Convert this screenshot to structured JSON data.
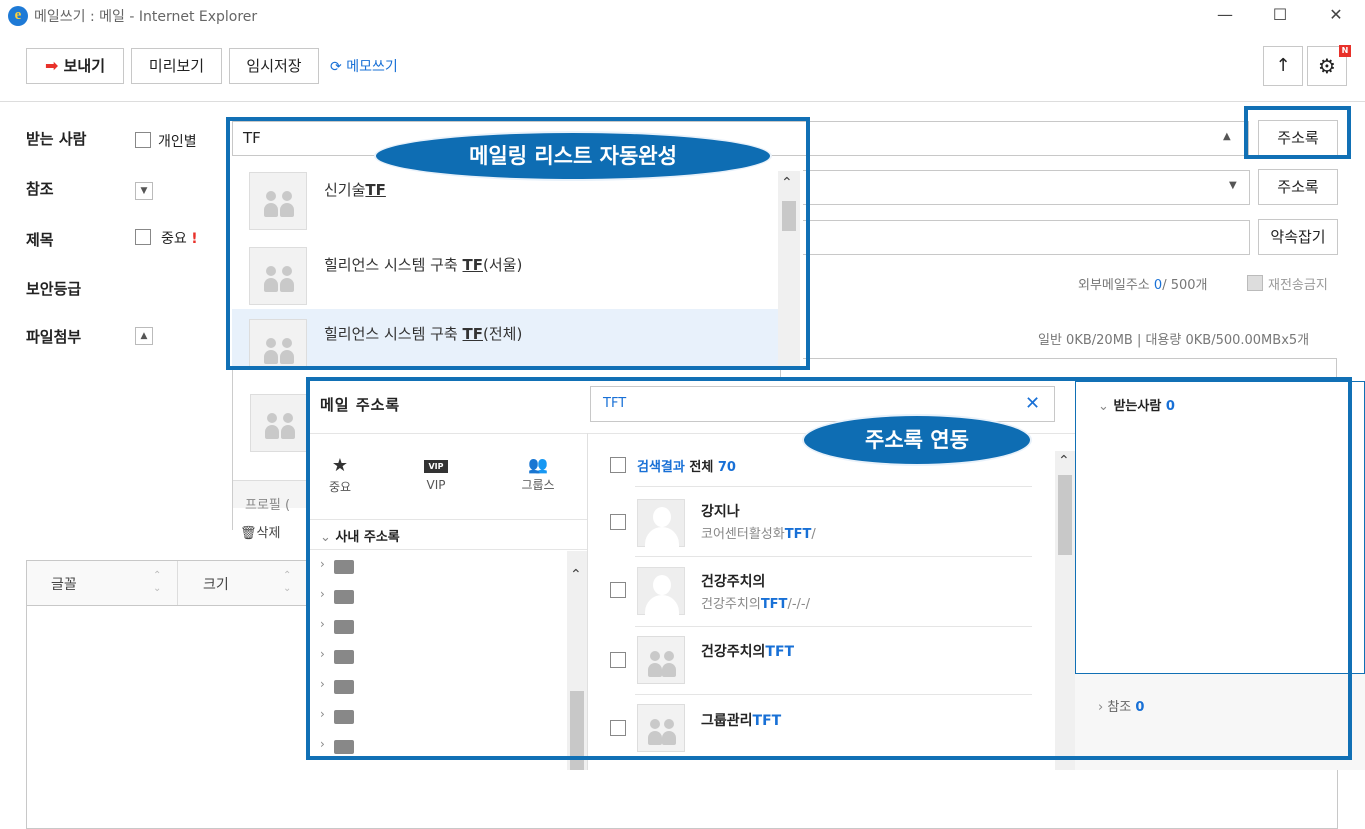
{
  "window": {
    "title": "메일쓰기 : 메일 - Internet Explorer",
    "minimize": "—",
    "maximize": "☐",
    "close": "✕"
  },
  "toolbar": {
    "send": "보내기",
    "preview": "미리보기",
    "draft": "임시저장",
    "memo": "메모쓰기",
    "upload_icon": "↑",
    "settings_badge": "N"
  },
  "form": {
    "to_label": "받는 사람",
    "individual_label": "개인별",
    "to_value": "TF",
    "address_book_btn": "주소록",
    "cc_label": "참조",
    "cc_address_book_btn": "주소록",
    "subject_label": "제목",
    "important_label": "중요",
    "important_mark": "!",
    "appointment_btn": "약속잡기",
    "security_label": "보안등급",
    "external_label": "외부메일주소",
    "external_count": "0",
    "external_limit": "/ 500개",
    "no_forward_label": "재전송금지",
    "attach_label": "파일첨부",
    "attach_info": "일반 0KB/20MB | 대용량 0KB/500.00MBx5개",
    "profile_text": "프로필 (",
    "delete_label": "삭제",
    "font_label": "글꼴",
    "size_label": "크기"
  },
  "autocomplete": {
    "callout": "메일링 리스트 자동완성",
    "items": [
      {
        "prefix": "신기술",
        "match": "TF",
        "suffix": ""
      },
      {
        "prefix": "힐리언스 시스템 구축 ",
        "match": "TF",
        "suffix": "(서울)"
      },
      {
        "prefix": "힐리언스 시스템 구축 ",
        "match": "TF",
        "suffix": "(전체)"
      }
    ]
  },
  "addressbook": {
    "title": "메일 주소록",
    "search_value": "TFT",
    "callout": "주소록 연동",
    "tabs": [
      {
        "label": "중요",
        "icon": "star-icon"
      },
      {
        "label": "VIP",
        "icon": "vip-icon"
      },
      {
        "label": "그룹스",
        "icon": "group-icon"
      }
    ],
    "tree_title": "사내 주소록",
    "select_all_label": "검색결과",
    "select_all_suffix": "전체",
    "total": "70",
    "contacts": [
      {
        "name": "강지나",
        "sub_prefix": "코어센터활성화",
        "sub_match": "TFT",
        "sub_suffix": "/",
        "type": "person"
      },
      {
        "name": "건강주치의",
        "sub_prefix": "건강주치의",
        "sub_match": "TFT",
        "sub_suffix": "/-/-/",
        "type": "person"
      },
      {
        "name": "건강주치의",
        "name_match": "TFT",
        "sub_prefix": "",
        "sub_match": "",
        "sub_suffix": "",
        "type": "group"
      },
      {
        "name": "그룹관리",
        "name_match": "TFT",
        "sub_prefix": "",
        "sub_match": "",
        "sub_suffix": "",
        "type": "group"
      }
    ],
    "recipients_label": "받는사람",
    "recipients_count": "0",
    "cc_label": "참조",
    "cc_count": "0"
  },
  "colors": {
    "accent": "#1170b5",
    "send_arrow": "#e8312a",
    "link_blue": "#1870d6"
  }
}
